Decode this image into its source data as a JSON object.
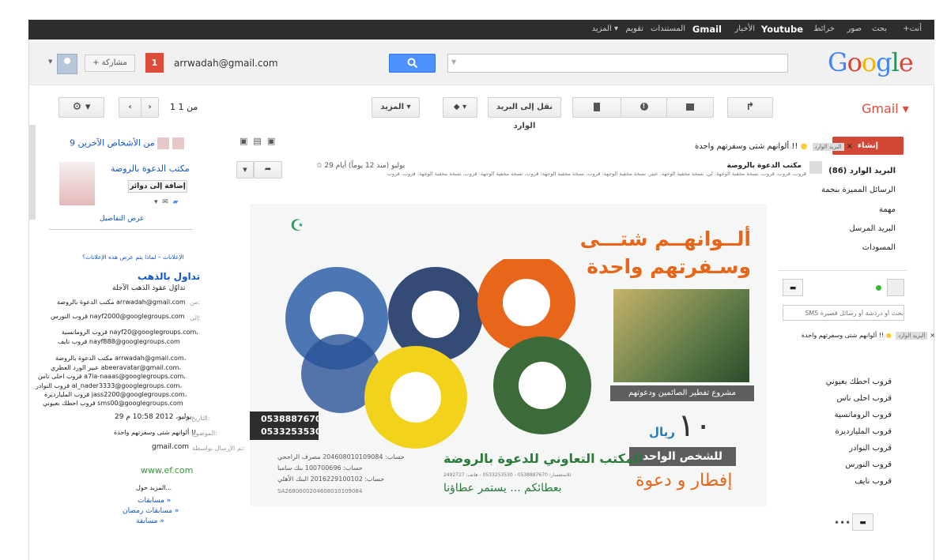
{
  "topbar": {
    "items": [
      "+أنت",
      "بحث",
      "صور",
      "خرائط",
      "Youtube",
      "الأخبار",
      "Gmail",
      "المستندات",
      "تقويم",
      "المزيد ▾"
    ]
  },
  "header": {
    "logo": "Google",
    "account_email": "arrwadah@gmail.com",
    "notifications": "1",
    "share_label": "+ مشاركة"
  },
  "toolbar": {
    "app_title": "Gmail ▾",
    "move_inbox": "نقل إلى البريد الوارد",
    "more": "المزيد ▾",
    "pager": "1 من 1"
  },
  "nav": {
    "compose": "إنشاء",
    "items": [
      "البريد الوارد (86)",
      "الرسائل المميزة بنجمة",
      "مهمة",
      "البريد المرسل",
      "المسودات"
    ]
  },
  "chat": {
    "search_placeholder": "بحث أو دردشة أو رسائل قصيرة SMS",
    "label_preview": "ألوانهم شتى وسفرتهم واحدة !!"
  },
  "groups": [
    "قروب احطك بعيوني",
    "قروب احلى ناس",
    "قروب الرومانسية",
    "قروب المليارديرة",
    "قروب النوادر",
    "قروب النورس",
    "قروب نايف"
  ],
  "message": {
    "subject": "ألوانهم شتى وسفرتهم واحدة !!",
    "labels": [
      "البريد الوارد"
    ],
    "sender": "مكتب الدعوة بالروضة",
    "recipients": "قروب، قروب، قروب، نسخة مخفية الوجهة: لي، نسخة مخفية الوجهة: عبير، نسخة مخفية الوجهة: قروب، نسخة مخفية الوجهة: قروب، نسخة مخفية الوجهة: قروب، نسخة مخفية الوجهة: قروب، قروب",
    "date": "29 يوليو (منذ 12 يوماً) أيام"
  },
  "poster": {
    "title1": "ألــوانهــم شتـــى",
    "title2": "وسـفرتهم واحدة",
    "project": "مشروع تفطير الصائمين ودعوتهم",
    "price_num": "١٠",
    "price_unit": "ريال",
    "per_person": "للشخص الواحد",
    "iftar": "إفطار و دعوة",
    "phone1": "0538887670",
    "phone2": "0533253530",
    "office": "المكتب التعاوني للدعوة بالروضة",
    "accounts": [
      "حساب: 204608010109084 مصرف الراجحي",
      "حساب: 100700696 بنك سامبا",
      "حساب: 2016229100102 البنك الأهلي"
    ],
    "iban": "SA2680000204608010109084",
    "slogan": "بعطائكم ... يستمر عطاؤنا",
    "contact": "للاستفسار: 0538887670 - 0533253530 - هاتف: 2492727"
  },
  "right": {
    "others": "9 من الأشخاص الآخرين",
    "contact_name": "مكتب الدعوة بالروضة",
    "add_circles": "إضافة إلى دوائر",
    "details": "عرض التفاصيل",
    "ads_why": "الإعلانات – لماذا يتم عرض هذه الإعلانات؟",
    "ad_title": "تداول بالذهب",
    "ad_sub": "تداوُل عقود الذهب الآجلة",
    "from_label": "من:",
    "from_value": "مكتب الدعوة بالروضة arrwadah@gmail.com",
    "to_label": "إلى:",
    "to_list": [
      "قروب النورس nayf2000@googlegroups.com",
      "قروب الرومانسية nayf20@googlegroups.com،",
      "قروب نايف nayf888@googlegroups.com",
      "مكتب الدعوة بالروضة arrwadah@gmail.com،",
      "عبير الورد العطري abeeravatar@gmail.com،",
      "قروب احلى ناس a7la-naaas@googlegroups.com،",
      "قروب النوادر al_nader3333@googlegroups.com،",
      "قروب المليارديرة jass2200@googlegroups.com،",
      "قروب احطك بعيوني sms00@googlegroups.com"
    ],
    "date_label": "التاريخ:",
    "date_value": "29 يوليو، 2012 10:58 م",
    "subject_label": "الموضوع:",
    "subject_value": "ألوانهم شتى وسفرتهم واحدة !!",
    "mailed_label": "تم الإرسال بواسطة:",
    "mailed_value": "gmail.com",
    "site": "www.ef.com",
    "more_about": "المزيد حول...",
    "links": [
      "مسابقات »",
      "مسابقات رمضان »",
      "مسابقة »"
    ]
  },
  "colors": {
    "google_blue": "#4285f4",
    "gmail_red": "#dd4b39",
    "search_blue": "#4d90fe"
  }
}
